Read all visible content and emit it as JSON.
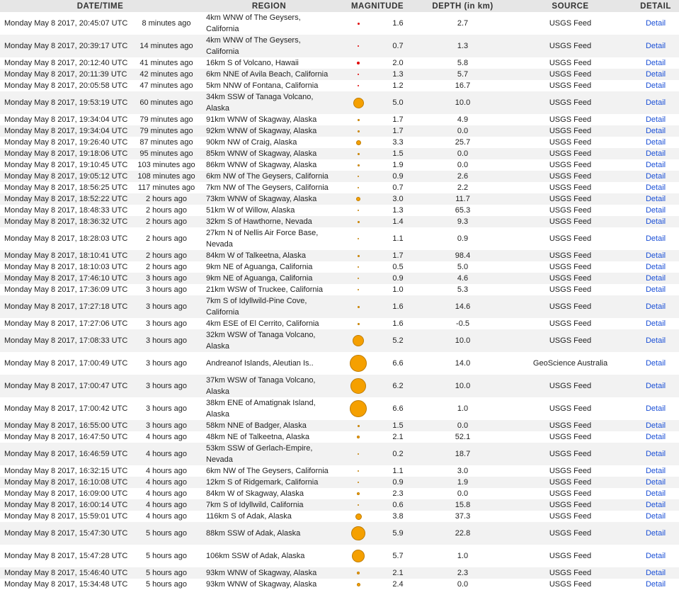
{
  "headers": {
    "datetime": "DATE/TIME",
    "region": "REGION",
    "magnitude": "MAGNITUDE",
    "depth": "DEPTH (in km)",
    "source": "SOURCE",
    "detail": "DETAIL"
  },
  "colors": {
    "recent": "#e00000",
    "older": "#f5a000",
    "link": "#1a4fd6"
  },
  "rows": [
    {
      "datetime": "Monday May 8 2017, 20:45:07 UTC",
      "ago": "8 minutes ago",
      "region": "4km WNW of The Geysers, California",
      "magnitude": "1.6",
      "depth": "2.7",
      "source": "USGS Feed",
      "detail": "Detail",
      "recent": true
    },
    {
      "datetime": "Monday May 8 2017, 20:39:17 UTC",
      "ago": "14 minutes ago",
      "region": "4km WNW of The Geysers, California",
      "magnitude": "0.7",
      "depth": "1.3",
      "source": "USGS Feed",
      "detail": "Detail",
      "recent": true
    },
    {
      "datetime": "Monday May 8 2017, 20:12:40 UTC",
      "ago": "41 minutes ago",
      "region": "16km S of Volcano, Hawaii",
      "magnitude": "2.0",
      "depth": "5.8",
      "source": "USGS Feed",
      "detail": "Detail",
      "recent": true
    },
    {
      "datetime": "Monday May 8 2017, 20:11:39 UTC",
      "ago": "42 minutes ago",
      "region": "6km NNE of Avila Beach, California",
      "magnitude": "1.3",
      "depth": "5.7",
      "source": "USGS Feed",
      "detail": "Detail",
      "recent": true
    },
    {
      "datetime": "Monday May 8 2017, 20:05:58 UTC",
      "ago": "47 minutes ago",
      "region": "5km NNW of Fontana, California",
      "magnitude": "1.2",
      "depth": "16.7",
      "source": "USGS Feed",
      "detail": "Detail",
      "recent": true
    },
    {
      "datetime": "Monday May 8 2017, 19:53:19 UTC",
      "ago": "60 minutes ago",
      "region": "34km SSW of Tanaga Volcano, Alaska",
      "magnitude": "5.0",
      "depth": "10.0",
      "source": "USGS Feed",
      "detail": "Detail",
      "tall": true
    },
    {
      "datetime": "Monday May 8 2017, 19:34:04 UTC",
      "ago": "79 minutes ago",
      "region": "91km WNW of Skagway, Alaska",
      "magnitude": "1.7",
      "depth": "4.9",
      "source": "USGS Feed",
      "detail": "Detail"
    },
    {
      "datetime": "Monday May 8 2017, 19:34:04 UTC",
      "ago": "79 minutes ago",
      "region": "92km WNW of Skagway, Alaska",
      "magnitude": "1.7",
      "depth": "0.0",
      "source": "USGS Feed",
      "detail": "Detail"
    },
    {
      "datetime": "Monday May 8 2017, 19:26:40 UTC",
      "ago": "87 minutes ago",
      "region": "90km NW of Craig, Alaska",
      "magnitude": "3.3",
      "depth": "25.7",
      "source": "USGS Feed",
      "detail": "Detail"
    },
    {
      "datetime": "Monday May 8 2017, 19:18:06 UTC",
      "ago": "95 minutes ago",
      "region": "85km WNW of Skagway, Alaska",
      "magnitude": "1.5",
      "depth": "0.0",
      "source": "USGS Feed",
      "detail": "Detail"
    },
    {
      "datetime": "Monday May 8 2017, 19:10:45 UTC",
      "ago": "103 minutes ago",
      "region": "86km WNW of Skagway, Alaska",
      "magnitude": "1.9",
      "depth": "0.0",
      "source": "USGS Feed",
      "detail": "Detail"
    },
    {
      "datetime": "Monday May 8 2017, 19:05:12 UTC",
      "ago": "108 minutes ago",
      "region": "6km NW of The Geysers, California",
      "magnitude": "0.9",
      "depth": "2.6",
      "source": "USGS Feed",
      "detail": "Detail"
    },
    {
      "datetime": "Monday May 8 2017, 18:56:25 UTC",
      "ago": "117 minutes ago",
      "region": "7km NW of The Geysers, California",
      "magnitude": "0.7",
      "depth": "2.2",
      "source": "USGS Feed",
      "detail": "Detail"
    },
    {
      "datetime": "Monday May 8 2017, 18:52:22 UTC",
      "ago": "2 hours ago",
      "region": "73km WNW of Skagway, Alaska",
      "magnitude": "3.0",
      "depth": "11.7",
      "source": "USGS Feed",
      "detail": "Detail"
    },
    {
      "datetime": "Monday May 8 2017, 18:48:33 UTC",
      "ago": "2 hours ago",
      "region": "51km W of Willow, Alaska",
      "magnitude": "1.3",
      "depth": "65.3",
      "source": "USGS Feed",
      "detail": "Detail"
    },
    {
      "datetime": "Monday May 8 2017, 18:36:32 UTC",
      "ago": "2 hours ago",
      "region": "32km S of Hawthorne, Nevada",
      "magnitude": "1.4",
      "depth": "9.3",
      "source": "USGS Feed",
      "detail": "Detail"
    },
    {
      "datetime": "Monday May 8 2017, 18:28:03 UTC",
      "ago": "2 hours ago",
      "region": "27km N of Nellis Air Force Base, Nevada",
      "magnitude": "1.1",
      "depth": "0.9",
      "source": "USGS Feed",
      "detail": "Detail",
      "tall": true
    },
    {
      "datetime": "Monday May 8 2017, 18:10:41 UTC",
      "ago": "2 hours ago",
      "region": "84km W of Talkeetna, Alaska",
      "magnitude": "1.7",
      "depth": "98.4",
      "source": "USGS Feed",
      "detail": "Detail"
    },
    {
      "datetime": "Monday May 8 2017, 18:10:03 UTC",
      "ago": "2 hours ago",
      "region": "9km NE of Aguanga, California",
      "magnitude": "0.5",
      "depth": "5.0",
      "source": "USGS Feed",
      "detail": "Detail"
    },
    {
      "datetime": "Monday May 8 2017, 17:46:10 UTC",
      "ago": "3 hours ago",
      "region": "9km NE of Aguanga, California",
      "magnitude": "0.9",
      "depth": "4.6",
      "source": "USGS Feed",
      "detail": "Detail"
    },
    {
      "datetime": "Monday May 8 2017, 17:36:09 UTC",
      "ago": "3 hours ago",
      "region": "21km WSW of Truckee, California",
      "magnitude": "1.0",
      "depth": "5.3",
      "source": "USGS Feed",
      "detail": "Detail"
    },
    {
      "datetime": "Monday May 8 2017, 17:27:18 UTC",
      "ago": "3 hours ago",
      "region": "7km S of Idyllwild-Pine Cove, California",
      "magnitude": "1.6",
      "depth": "14.6",
      "source": "USGS Feed",
      "detail": "Detail",
      "tall": true
    },
    {
      "datetime": "Monday May 8 2017, 17:27:06 UTC",
      "ago": "3 hours ago",
      "region": "4km ESE of El Cerrito, California",
      "magnitude": "1.6",
      "depth": "-0.5",
      "source": "USGS Feed",
      "detail": "Detail"
    },
    {
      "datetime": "Monday May 8 2017, 17:08:33 UTC",
      "ago": "3 hours ago",
      "region": "32km WSW of Tanaga Volcano, Alaska",
      "magnitude": "5.2",
      "depth": "10.0",
      "source": "USGS Feed",
      "detail": "Detail",
      "tall": true
    },
    {
      "datetime": "Monday May 8 2017, 17:00:49 UTC",
      "ago": "3 hours ago",
      "region": "Andreanof Islands, Aleutian Is..",
      "magnitude": "6.6",
      "depth": "14.0",
      "source": "GeoScience Australia",
      "detail": "Detail",
      "tall": true
    },
    {
      "datetime": "Monday May 8 2017, 17:00:47 UTC",
      "ago": "3 hours ago",
      "region": "37km WSW of Tanaga Volcano, Alaska",
      "magnitude": "6.2",
      "depth": "10.0",
      "source": "USGS Feed",
      "detail": "Detail",
      "tall": true
    },
    {
      "datetime": "Monday May 8 2017, 17:00:42 UTC",
      "ago": "3 hours ago",
      "region": "38km ENE of Amatignak Island, Alaska",
      "magnitude": "6.6",
      "depth": "1.0",
      "source": "USGS Feed",
      "detail": "Detail",
      "tall": true
    },
    {
      "datetime": "Monday May 8 2017, 16:55:00 UTC",
      "ago": "3 hours ago",
      "region": "58km NNE of Badger, Alaska",
      "magnitude": "1.5",
      "depth": "0.0",
      "source": "USGS Feed",
      "detail": "Detail"
    },
    {
      "datetime": "Monday May 8 2017, 16:47:50 UTC",
      "ago": "4 hours ago",
      "region": "48km NE of Talkeetna, Alaska",
      "magnitude": "2.1",
      "depth": "52.1",
      "source": "USGS Feed",
      "detail": "Detail"
    },
    {
      "datetime": "Monday May 8 2017, 16:46:59 UTC",
      "ago": "4 hours ago",
      "region": "53km SSW of Gerlach-Empire, Nevada",
      "magnitude": "0.2",
      "depth": "18.7",
      "source": "USGS Feed",
      "detail": "Detail",
      "tall": true
    },
    {
      "datetime": "Monday May 8 2017, 16:32:15 UTC",
      "ago": "4 hours ago",
      "region": "6km NW of The Geysers, California",
      "magnitude": "1.1",
      "depth": "3.0",
      "source": "USGS Feed",
      "detail": "Detail"
    },
    {
      "datetime": "Monday May 8 2017, 16:10:08 UTC",
      "ago": "4 hours ago",
      "region": "12km S of Ridgemark, California",
      "magnitude": "0.9",
      "depth": "1.9",
      "source": "USGS Feed",
      "detail": "Detail"
    },
    {
      "datetime": "Monday May 8 2017, 16:09:00 UTC",
      "ago": "4 hours ago",
      "region": "84km W of Skagway, Alaska",
      "magnitude": "2.3",
      "depth": "0.0",
      "source": "USGS Feed",
      "detail": "Detail"
    },
    {
      "datetime": "Monday May 8 2017, 16:00:14 UTC",
      "ago": "4 hours ago",
      "region": "7km S of Idyllwild, California",
      "magnitude": "0.6",
      "depth": "15.8",
      "source": "USGS Feed",
      "detail": "Detail"
    },
    {
      "datetime": "Monday May 8 2017, 15:59:01 UTC",
      "ago": "4 hours ago",
      "region": "116km S of Adak, Alaska",
      "magnitude": "3.8",
      "depth": "37.3",
      "source": "USGS Feed",
      "detail": "Detail"
    },
    {
      "datetime": "Monday May 8 2017, 15:47:30 UTC",
      "ago": "5 hours ago",
      "region": "88km SSW of Adak, Alaska",
      "magnitude": "5.9",
      "depth": "22.8",
      "source": "USGS Feed",
      "detail": "Detail",
      "tall": true
    },
    {
      "datetime": "Monday May 8 2017, 15:47:28 UTC",
      "ago": "5 hours ago",
      "region": "106km SSW of Adak, Alaska",
      "magnitude": "5.7",
      "depth": "1.0",
      "source": "USGS Feed",
      "detail": "Detail",
      "tall": true
    },
    {
      "datetime": "Monday May 8 2017, 15:46:40 UTC",
      "ago": "5 hours ago",
      "region": "93km WNW of Skagway, Alaska",
      "magnitude": "2.1",
      "depth": "2.3",
      "source": "USGS Feed",
      "detail": "Detail"
    },
    {
      "datetime": "Monday May 8 2017, 15:34:48 UTC",
      "ago": "5 hours ago",
      "region": "93km WNW of Skagway, Alaska",
      "magnitude": "2.4",
      "depth": "0.0",
      "source": "USGS Feed",
      "detail": "Detail"
    }
  ]
}
